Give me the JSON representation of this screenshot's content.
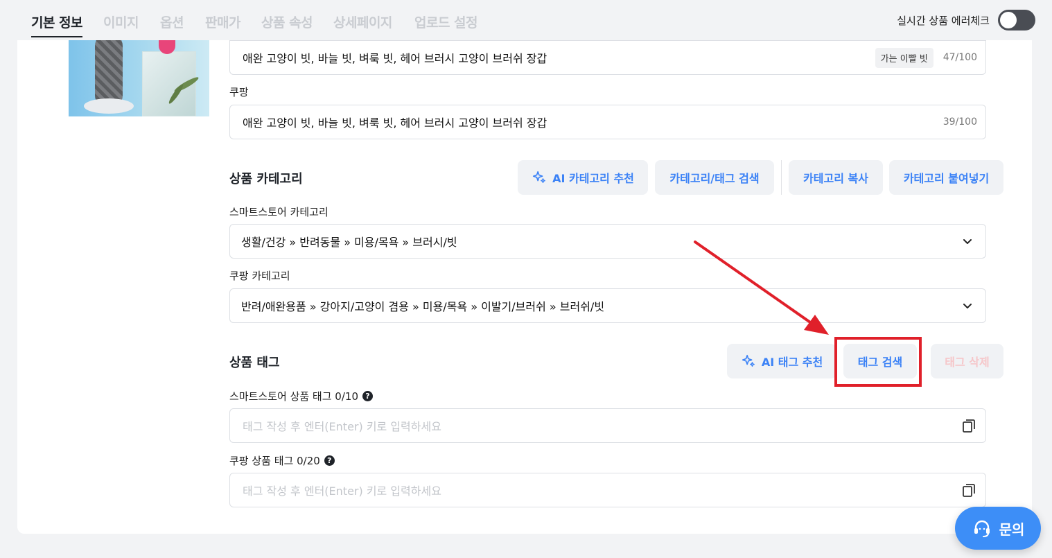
{
  "tabs": [
    {
      "label": "기본 정보",
      "active": true
    },
    {
      "label": "이미지"
    },
    {
      "label": "옵션"
    },
    {
      "label": "판매가"
    },
    {
      "label": "상품 속성"
    },
    {
      "label": "상세페이지"
    },
    {
      "label": "업로드 설정"
    }
  ],
  "realtime_check": {
    "label": "실시간 상품 에러체크",
    "enabled": false
  },
  "title_smartstore": {
    "value": "애완 고양이 빗, 바늘 빗, 벼룩 빗, 헤어 브러시 고양이 브러쉬 장갑",
    "badge": "가는 이빨 빗",
    "counter": "47/100"
  },
  "title_coupang": {
    "label": "쿠팡",
    "value": "애완 고양이 빗, 바늘 빗, 벼룩 빗, 헤어 브러시 고양이 브러쉬 장갑",
    "counter": "39/100"
  },
  "category": {
    "title": "상품 카테고리",
    "buttons": {
      "ai_recommend": "AI 카테고리 추천",
      "search": "카테고리/태그 검색",
      "copy": "카테고리 복사",
      "paste": "카테고리 붙여넣기"
    },
    "smartstore_label": "스마트스토어 카테고리",
    "smartstore_value": "생활/건강 » 반려동물 » 미용/목욕 » 브러시/빗",
    "coupang_label": "쿠팡 카테고리",
    "coupang_value": "반려/애완용품 » 강아지/고양이 겸용 » 미용/목욕 » 이발기/브러쉬 » 브러쉬/빗"
  },
  "tags": {
    "title": "상품 태그",
    "buttons": {
      "ai_recommend": "AI 태그 추천",
      "search": "태그 검색",
      "delete": "태그 삭제"
    },
    "smartstore_label": "스마트스토어 상품 태그 0/10",
    "coupang_label": "쿠팡 상품 태그 0/20",
    "placeholder": "태그 작성 후 엔터(Enter) 키로 입력하세요"
  },
  "chat": {
    "label": "문의"
  },
  "colors": {
    "accent": "#3b82f6",
    "highlight": "#e0202a",
    "chat": "#3d8ef7"
  },
  "icons": [
    "sparkle-icon",
    "chevron-down-icon",
    "copy-icon",
    "help-icon",
    "headset-icon"
  ]
}
